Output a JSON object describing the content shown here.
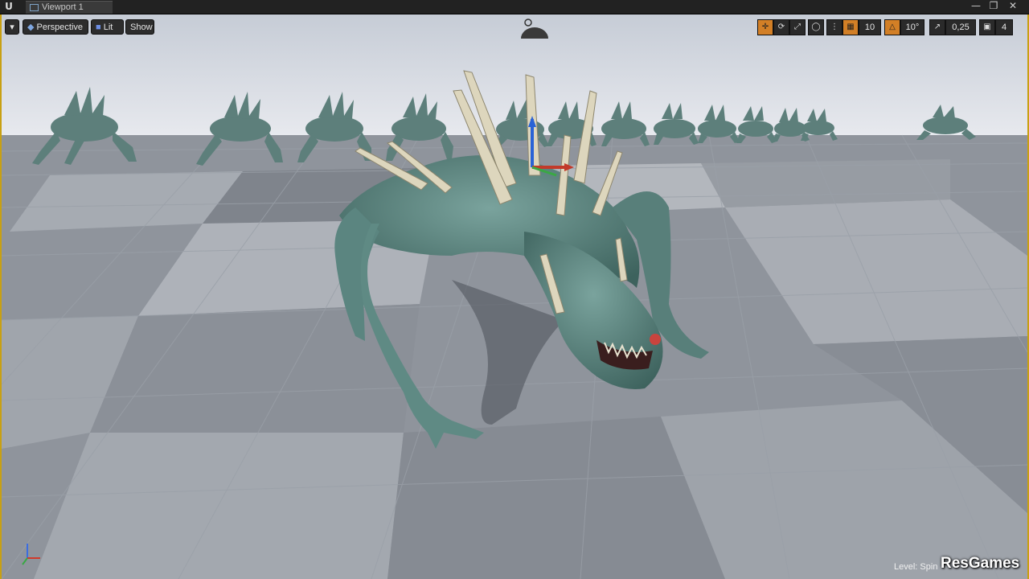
{
  "titlebar": {
    "tab_label": "Viewport 1",
    "minimize_glyph": "—",
    "restore_glyph": "❐",
    "close_glyph": "✕"
  },
  "viewport_toolbar": {
    "menu_glyph": "▾",
    "perspective_label": "Perspective",
    "lit_label": "Lit",
    "show_label": "Show",
    "grid_snap_value": "10",
    "rotation_snap_value": "10°",
    "scale_snap_value": "0,25",
    "camera_speed_value": "4"
  },
  "status": {
    "level_label": "Level:",
    "level_name": "Spin"
  },
  "watermark": "ResGames",
  "icons": {
    "translate": "move-icon",
    "rotate": "rotate-icon",
    "scale": "scale-icon",
    "world": "globe-icon",
    "surface_snap": "surface-snap-icon",
    "grid": "grid-icon",
    "angle": "angle-icon",
    "scale_snap": "scale-snap-icon",
    "camera": "camera-speed-icon"
  },
  "colors": {
    "active_tool": "#d27f26",
    "viewport_border": "#c8a012",
    "creature_skin": "#5f8c86"
  }
}
